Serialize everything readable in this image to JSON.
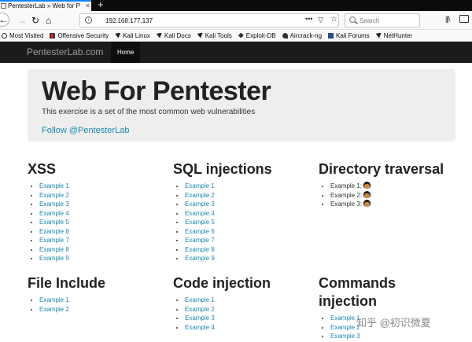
{
  "browser": {
    "tab_title": "PentesterLab » Web for P",
    "url": "192.168.177.137",
    "search_placeholder": "Search",
    "bookmarks": [
      {
        "label": "Most Visited",
        "icon": "gear-icon"
      },
      {
        "label": "Offensive Security",
        "icon": "offsec-icon"
      },
      {
        "label": "Kali Linux",
        "icon": "kali-dragon-icon"
      },
      {
        "label": "Kali Docs",
        "icon": "kali-dragon-icon"
      },
      {
        "label": "Kali Tools",
        "icon": "kali-dragon-icon"
      },
      {
        "label": "Exploit-DB",
        "icon": "exploit-db-icon"
      },
      {
        "label": "Aircrack-ng",
        "icon": "aircrack-icon"
      },
      {
        "label": "Kali Forums",
        "icon": "forums-icon"
      },
      {
        "label": "NetHunter",
        "icon": "kali-dragon-icon"
      }
    ]
  },
  "site": {
    "brand": "PentesterLab.com",
    "nav_home": "Home"
  },
  "hero": {
    "title": "Web For Pentester",
    "subtitle": "This exercise is a set of the most common web vulnerabilities",
    "follow_link": "Follow @PentesterLab"
  },
  "sections": {
    "xss": {
      "title": "XSS",
      "items": [
        "Example 1",
        "Example 2",
        "Example 3",
        "Example 4",
        "Example 5",
        "Example 6",
        "Example 7",
        "Example 8",
        "Example 9"
      ]
    },
    "sqli": {
      "title": "SQL injections",
      "items": [
        "Example 1",
        "Example 2",
        "Example 3",
        "Example 4",
        "Example 5",
        "Example 6",
        "Example 7",
        "Example 8",
        "Example 9"
      ]
    },
    "dirtrav": {
      "title": "Directory traversal",
      "items": [
        "Example 1:",
        "Example 2:",
        "Example 3:"
      ]
    },
    "fileinc": {
      "title": "File Include",
      "items": [
        "Example 1",
        "Example 2"
      ]
    },
    "codeinj": {
      "title": "Code injection",
      "items": [
        "Example 1",
        "Example 2",
        "Example 3",
        "Example 4"
      ]
    },
    "cmdinj": {
      "title": "Commands injection",
      "items": [
        "Example 1",
        "Example 2",
        "Example 3"
      ]
    }
  },
  "watermark": "知乎 @初识微夏"
}
